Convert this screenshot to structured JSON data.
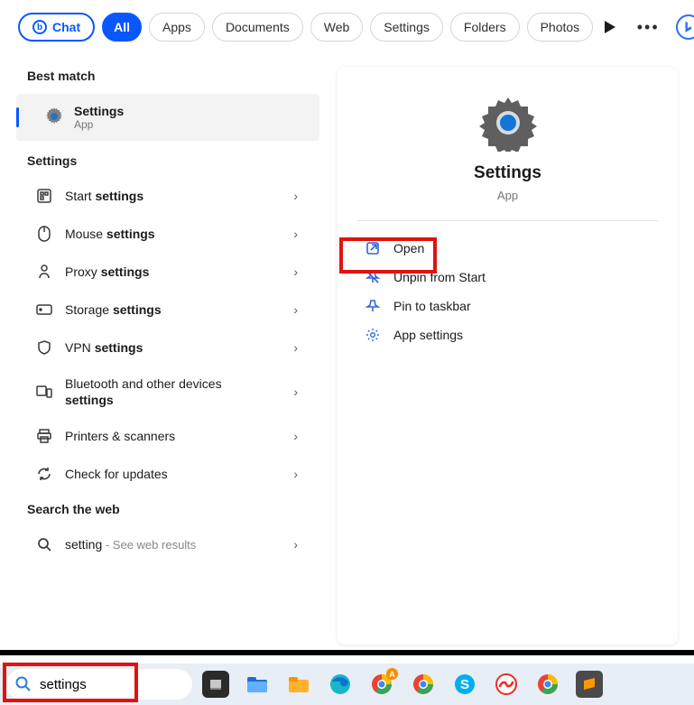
{
  "tabs": {
    "chat": "Chat",
    "all": "All",
    "apps": "Apps",
    "documents": "Documents",
    "web": "Web",
    "settings": "Settings",
    "folders": "Folders",
    "photos": "Photos"
  },
  "left": {
    "best_match_heading": "Best match",
    "best": {
      "title": "Settings",
      "subtitle": "App"
    },
    "settings_heading": "Settings",
    "items": [
      {
        "prefix": "Start ",
        "bold": "settings"
      },
      {
        "prefix": "Mouse ",
        "bold": "settings"
      },
      {
        "prefix": "Proxy ",
        "bold": "settings"
      },
      {
        "prefix": "Storage ",
        "bold": "settings"
      },
      {
        "prefix": "VPN ",
        "bold": "settings"
      },
      {
        "prefix": "Bluetooth and other devices ",
        "bold": "settings"
      },
      {
        "prefix": "Printers & scanners",
        "bold": ""
      },
      {
        "prefix": "Check for updates",
        "bold": ""
      }
    ],
    "web_heading": "Search the web",
    "web": {
      "term": "setting",
      "suffix": " - See web results"
    }
  },
  "right": {
    "title": "Settings",
    "subtitle": "App",
    "actions": {
      "open": "Open",
      "unpin": "Unpin from Start",
      "pin_taskbar": "Pin to taskbar",
      "app_settings": "App settings"
    }
  },
  "taskbar": {
    "search_value": "settings"
  }
}
